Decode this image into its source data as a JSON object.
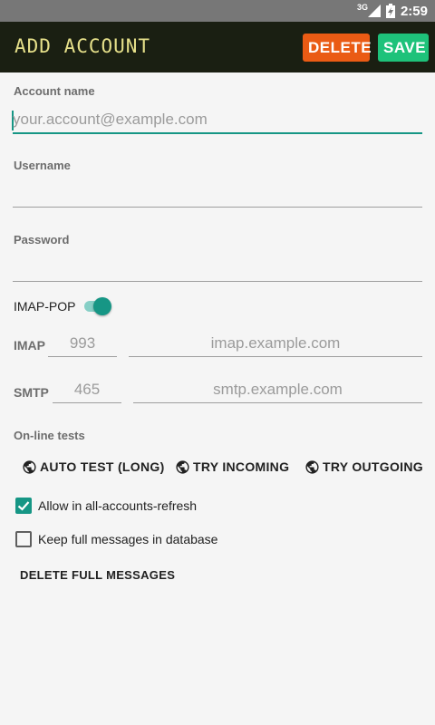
{
  "status": {
    "network": "3G",
    "time": "2:59"
  },
  "appbar": {
    "title": "ADD ACCOUNT",
    "delete_label": "DELETE",
    "save_label": "SAVE"
  },
  "form": {
    "account_name": {
      "label": "Account name",
      "placeholder": "your.account@example.com",
      "value": ""
    },
    "username": {
      "label": "Username",
      "value": ""
    },
    "password": {
      "label": "Password",
      "value": ""
    },
    "protocol": {
      "label": "IMAP-POP",
      "toggle_on": true
    },
    "imap": {
      "label": "IMAP",
      "port_placeholder": "993",
      "host_placeholder": "imap.example.com"
    },
    "smtp": {
      "label": "SMTP",
      "port_placeholder": "465",
      "host_placeholder": "smtp.example.com"
    }
  },
  "tests": {
    "label": "On-line tests",
    "buttons": [
      {
        "label": "AUTO TEST (LONG)",
        "icon": "globe-icon"
      },
      {
        "label": "TRY INCOMING",
        "icon": "globe-icon"
      },
      {
        "label": "TRY OUTGOING",
        "icon": "globe-icon"
      }
    ]
  },
  "options": [
    {
      "label": "Allow in all-accounts-refresh",
      "checked": true
    },
    {
      "label": "Keep full messages in database",
      "checked": false
    }
  ],
  "delete_full_label": "DELETE FULL MESSAGES",
  "colors": {
    "accent": "#169685",
    "appbar": "#1a1f12",
    "title": "#e6e08a",
    "delete": "#ea5b14",
    "save": "#1ec27a"
  }
}
